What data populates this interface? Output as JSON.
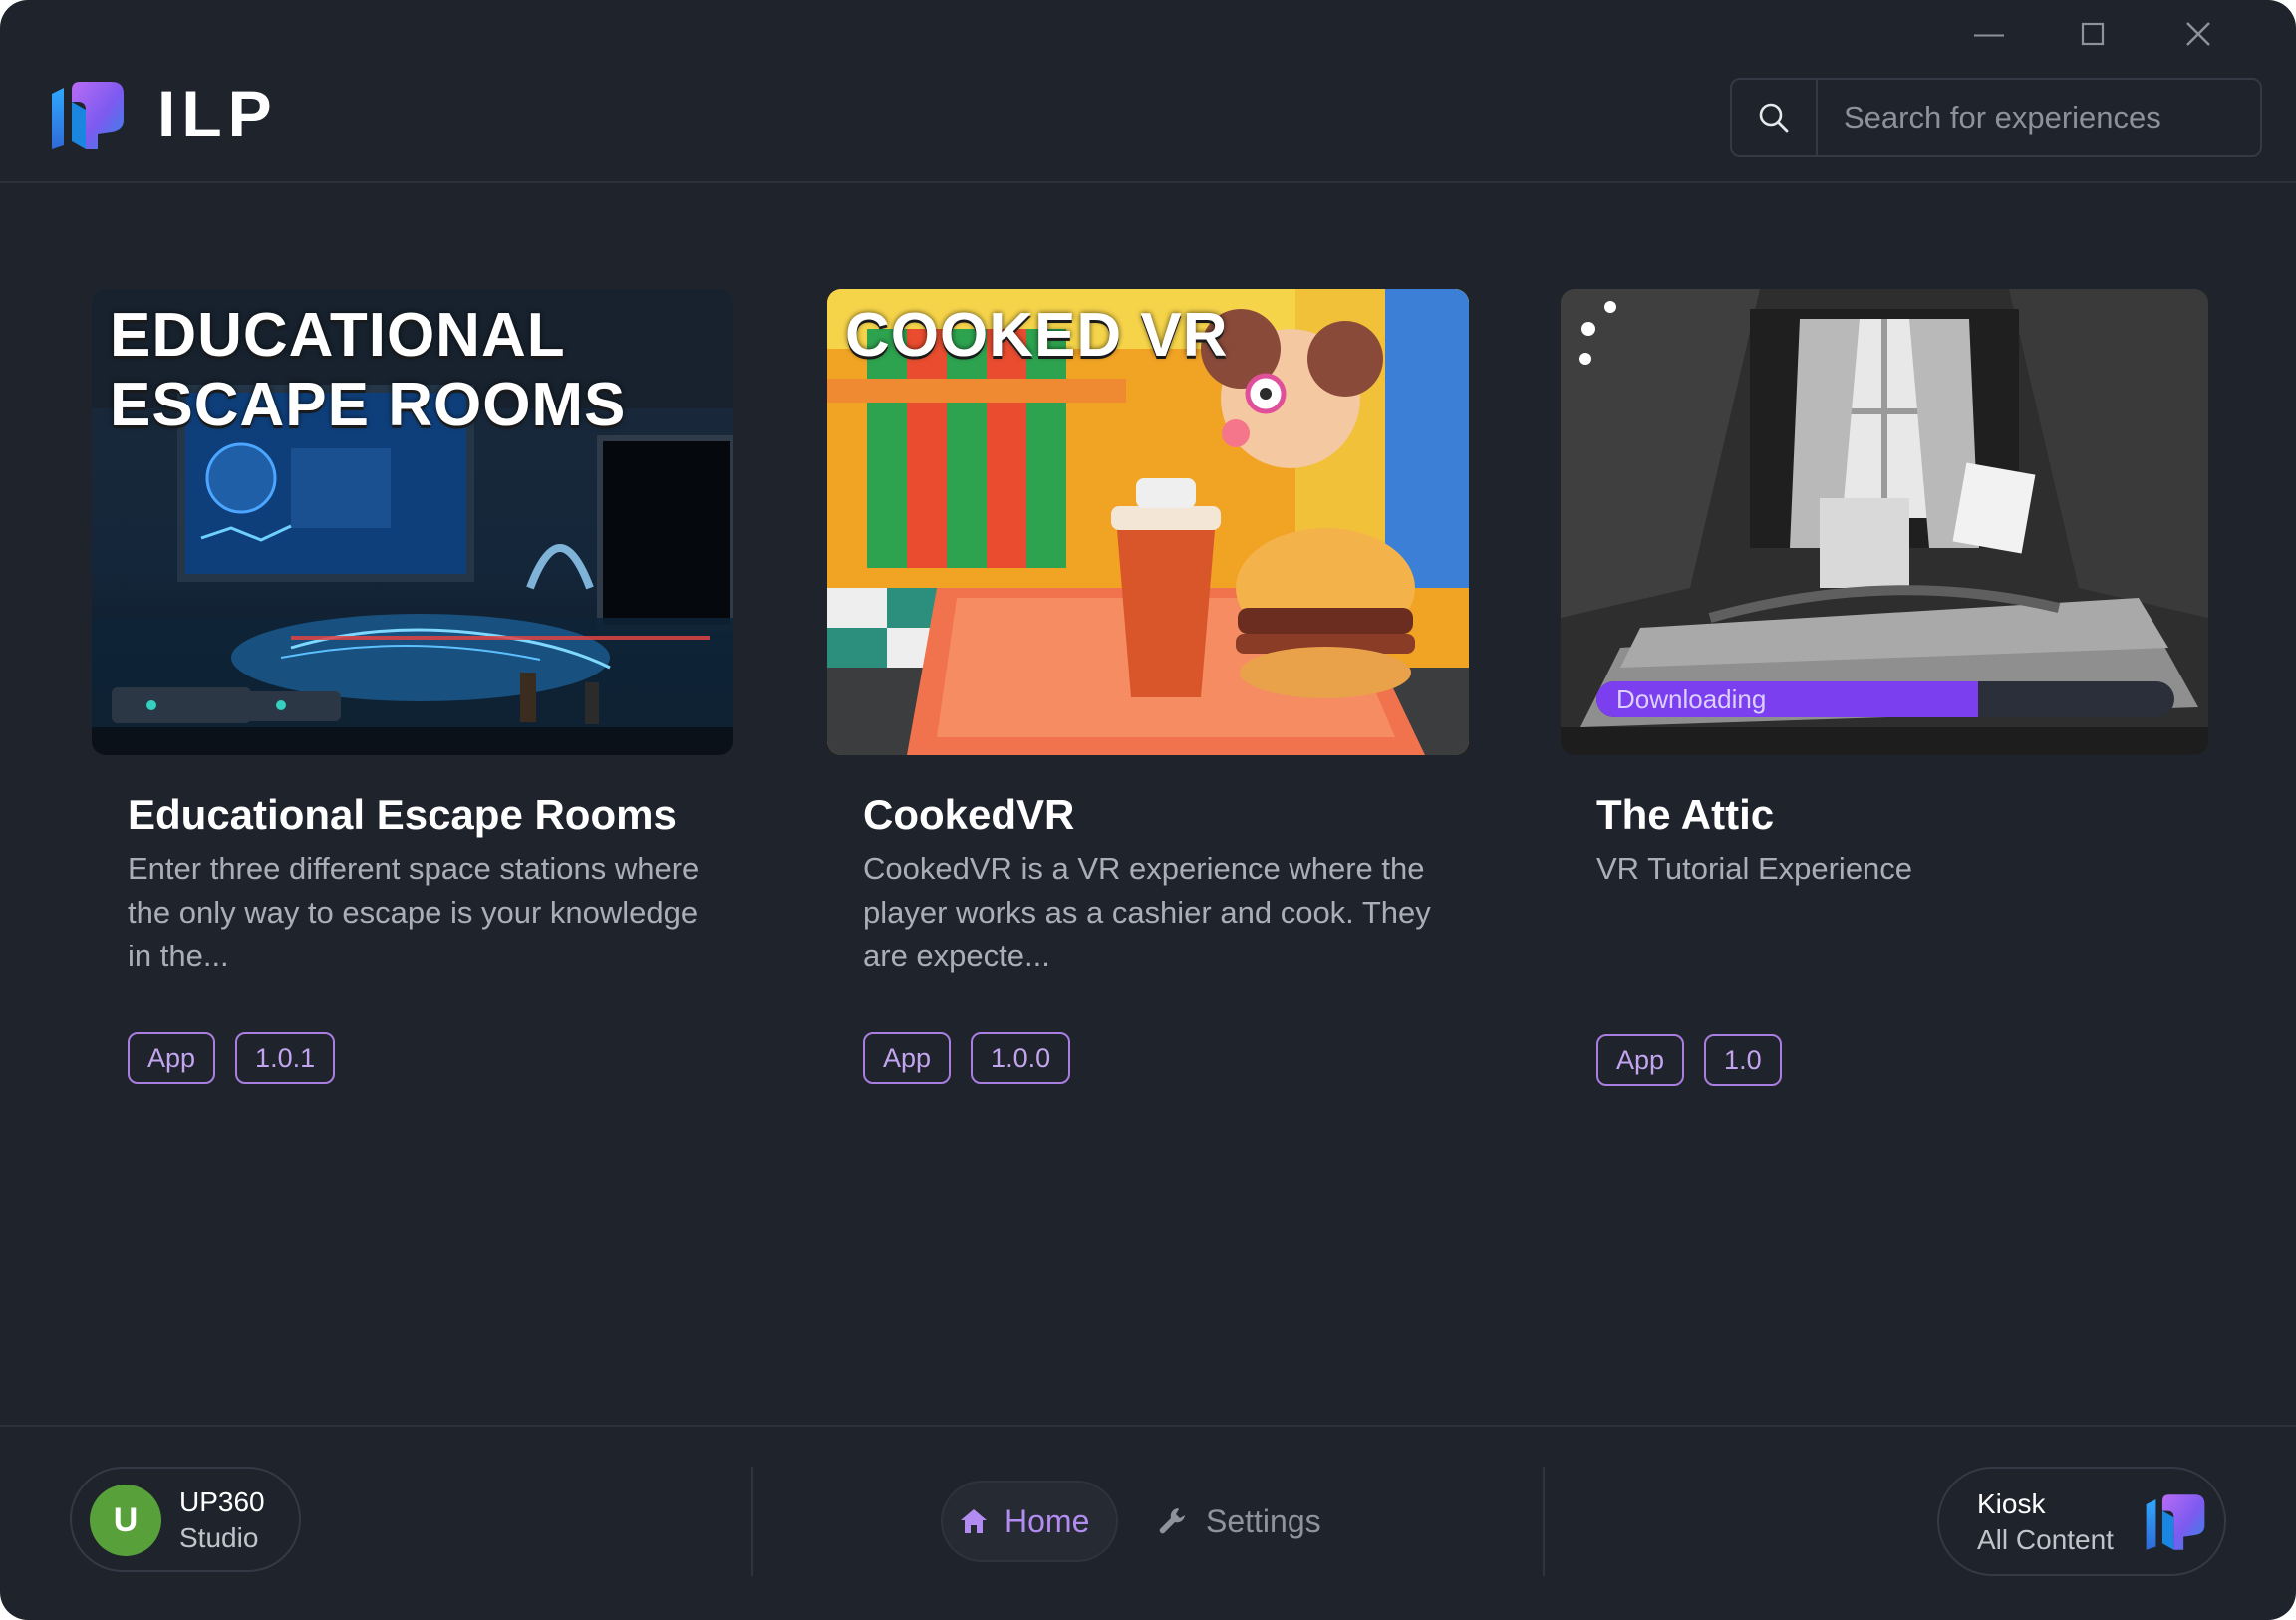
{
  "app": {
    "brand": "ILP"
  },
  "window_controls": {
    "minimize": "—",
    "maximize": "☐",
    "close": "✕"
  },
  "search": {
    "placeholder": "Search for experiences",
    "icon": "search-icon"
  },
  "cards": [
    {
      "thumb_title_line1": "EDUCATIONAL",
      "thumb_title_line2": "ESCAPE ROOMS",
      "title": "Educational Escape Rooms",
      "description": "Enter three different space stations where the only way to escape is your knowledge in the...",
      "tags": [
        "App",
        "1.0.1"
      ]
    },
    {
      "thumb_title_line1": "COOKED VR",
      "title": "CookedVR",
      "description": "CookedVR is a VR experience where the player works as a cashier and cook. They are expecte...",
      "tags": [
        "App",
        "1.0.0"
      ]
    },
    {
      "title": "The Attic",
      "description": "VR Tutorial Experience",
      "tags": [
        "App",
        "1.0"
      ],
      "download": {
        "label": "Downloading",
        "progress": 0.66
      }
    }
  ],
  "user": {
    "initial": "U",
    "name": "UP360",
    "org": "Studio"
  },
  "nav": {
    "home": "Home",
    "settings": "Settings",
    "active": "home"
  },
  "kiosk": {
    "mode": "Kiosk",
    "content": "All Content"
  },
  "colors": {
    "background": "#1f232c",
    "accent": "#7b3ff0",
    "tag_border": "#a97ee0",
    "avatar": "#58a13a"
  }
}
